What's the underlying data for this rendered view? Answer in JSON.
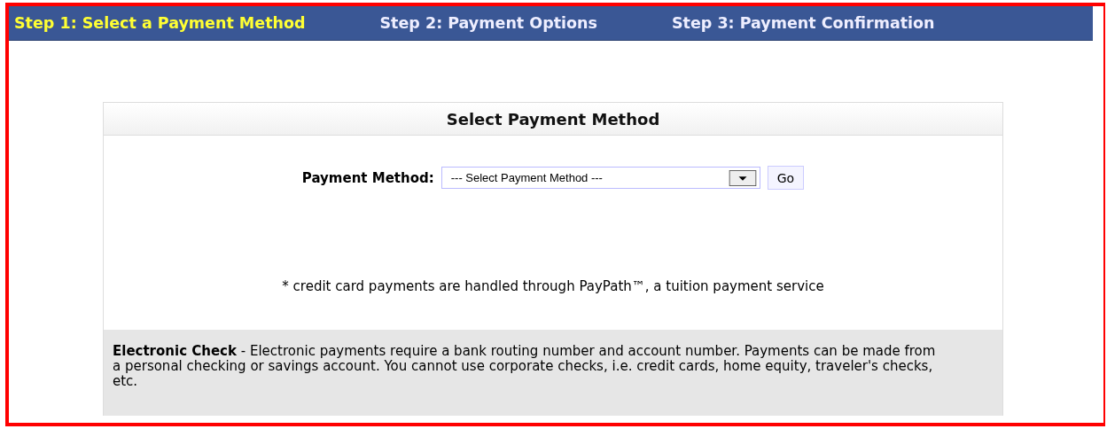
{
  "steps": [
    {
      "label": "Step 1: Select a Payment Method",
      "selected": true
    },
    {
      "label": "Step 2: Payment Options",
      "selected": false
    },
    {
      "label": "Step 3: Payment Confirmation",
      "selected": false
    }
  ],
  "panel": {
    "title": "Select Payment Method",
    "field_label": "Payment Method:",
    "select_value": "--- Select Payment Method ---",
    "go_button": "Go",
    "note": "* credit card payments are handled through PayPath™, a tuition payment service",
    "info": "**Electronic Check** - Electronic payments require a bank routing number and account number. Payments can be made from a personal checking or savings account. You cannot use corporate checks, i.e. credit cards, home equity, traveler's checks, etc."
  }
}
